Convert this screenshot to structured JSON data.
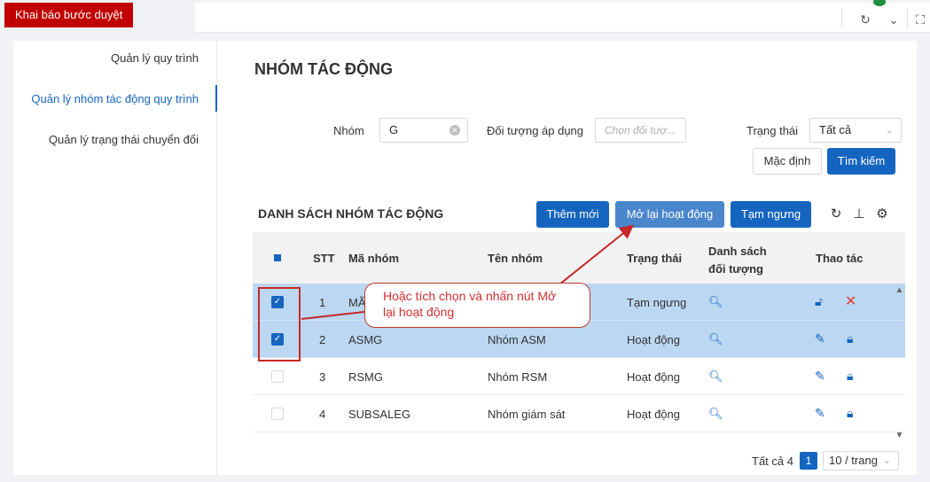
{
  "topbar": {
    "tab_label": "Khai báo bước duyệt",
    "icons": [
      "refresh-icon",
      "chevron-down-icon",
      "fullscreen-icon"
    ]
  },
  "sidebar": {
    "items": [
      {
        "label": "Quản lý quy trình",
        "active": false
      },
      {
        "label": "Quản lý nhóm tác động quy trình",
        "active": true
      },
      {
        "label": "Quản lý trạng thái chuyển đổi",
        "active": false
      }
    ]
  },
  "page": {
    "title": "NHÓM TÁC ĐỘNG"
  },
  "filters": {
    "group_label": "Nhóm",
    "group_value": "G",
    "object_label": "Đối tượng áp dụng",
    "object_placeholder": "Chọn đối tượ...",
    "status_label": "Trạng thái",
    "status_value": "Tất cả",
    "default_button": "Mặc định",
    "search_button": "Tìm kiếm"
  },
  "list": {
    "title": "DANH SÁCH NHÓM TÁC ĐỘNG",
    "add_button": "Thêm mới",
    "reactivate_button": "Mở lại hoạt động",
    "suspend_button": "Tạm ngưng",
    "columns": {
      "stt": "STT",
      "code": "Mã nhóm",
      "name": "Tên nhóm",
      "status": "Trạng thái",
      "objects_line1": "Danh sách",
      "objects_line2": "đối tượng",
      "actions": "Thao tác"
    },
    "rows": [
      {
        "stt": "1",
        "code": "MÃ",
        "name": "",
        "status": "Tạm ngưng",
        "selected": true
      },
      {
        "stt": "2",
        "code": "ASMG",
        "name": "Nhóm ASM",
        "status": "Hoạt động",
        "selected": true
      },
      {
        "stt": "3",
        "code": "RSMG",
        "name": "Nhóm RSM",
        "status": "Hoạt động",
        "selected": false
      },
      {
        "stt": "4",
        "code": "SUBSALEG",
        "name": "Nhóm giám sát",
        "status": "Hoạt động",
        "selected": false
      }
    ]
  },
  "pager": {
    "total": "Tất cả 4",
    "page": "1",
    "page_size": "10 / trang"
  },
  "annotation": {
    "text": "Hoặc tích chọn và nhấn nút Mở lại hoạt động",
    "color": "#c62828"
  },
  "colors": {
    "primary": "#1565c0",
    "selected_row": "#bcd7f1",
    "tab_badge": "#c00000"
  }
}
